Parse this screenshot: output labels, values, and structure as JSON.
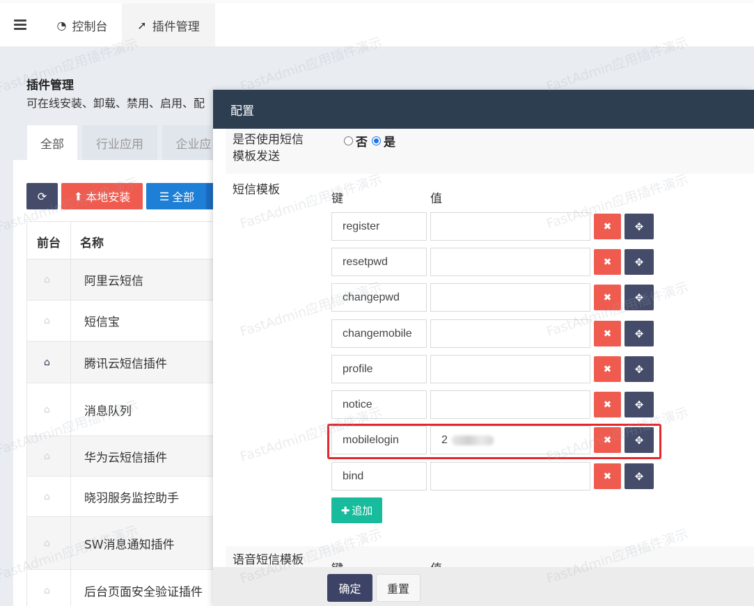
{
  "topnav": {
    "tabs": [
      {
        "label": "控制台",
        "icon": "dashboard-icon"
      },
      {
        "label": "插件管理",
        "icon": "rocket-icon"
      }
    ]
  },
  "page": {
    "title": "插件管理",
    "description": "可在线安装、卸载、禁用、启用、配"
  },
  "subtabs": [
    "全部",
    "行业应用",
    "企业应"
  ],
  "toolbar": {
    "local_install": "本地安装",
    "all": "全部"
  },
  "table": {
    "headers": [
      "前台",
      "名称"
    ],
    "rows": [
      {
        "name": "阿里云短信",
        "home_active": false
      },
      {
        "name": "短信宝",
        "home_active": false
      },
      {
        "name": "腾讯云短信插件",
        "home_active": true
      },
      {
        "name": "消息队列",
        "home_active": false
      },
      {
        "name": "华为云短信插件",
        "home_active": false
      },
      {
        "name": "晓羽服务监控助手",
        "home_active": false
      },
      {
        "name": "SW消息通知插件",
        "home_active": false
      },
      {
        "name": "后台页面安全验证插件",
        "home_active": false
      }
    ]
  },
  "modal": {
    "title": "配置",
    "field_use_template": {
      "label_line1": "是否使用短信",
      "label_line2": "模板发送",
      "option_no": "否",
      "option_yes": "是",
      "selected": "是"
    },
    "field_sms_template": {
      "label": "短信模板",
      "key_header": "键",
      "value_header": "值",
      "rows": [
        {
          "key": "register",
          "value": ""
        },
        {
          "key": "resetpwd",
          "value": ""
        },
        {
          "key": "changepwd",
          "value": ""
        },
        {
          "key": "changemobile",
          "value": ""
        },
        {
          "key": "profile",
          "value": ""
        },
        {
          "key": "notice",
          "value": ""
        },
        {
          "key": "mobilelogin",
          "value": "2"
        },
        {
          "key": "bind",
          "value": ""
        }
      ],
      "add_label": "追加"
    },
    "field_voice_template": {
      "label": "语音短信模板",
      "key_header": "键",
      "value_header": "值"
    },
    "confirm_label": "确定",
    "reset_label": "重置"
  },
  "watermark": "FastAdmin应用插件演示",
  "colors": {
    "header_bg": "#2c3e50",
    "danger": "#f05b4f",
    "primary_dark": "#444c69",
    "success": "#18bc9c",
    "highlight_border": "#e5262b"
  }
}
